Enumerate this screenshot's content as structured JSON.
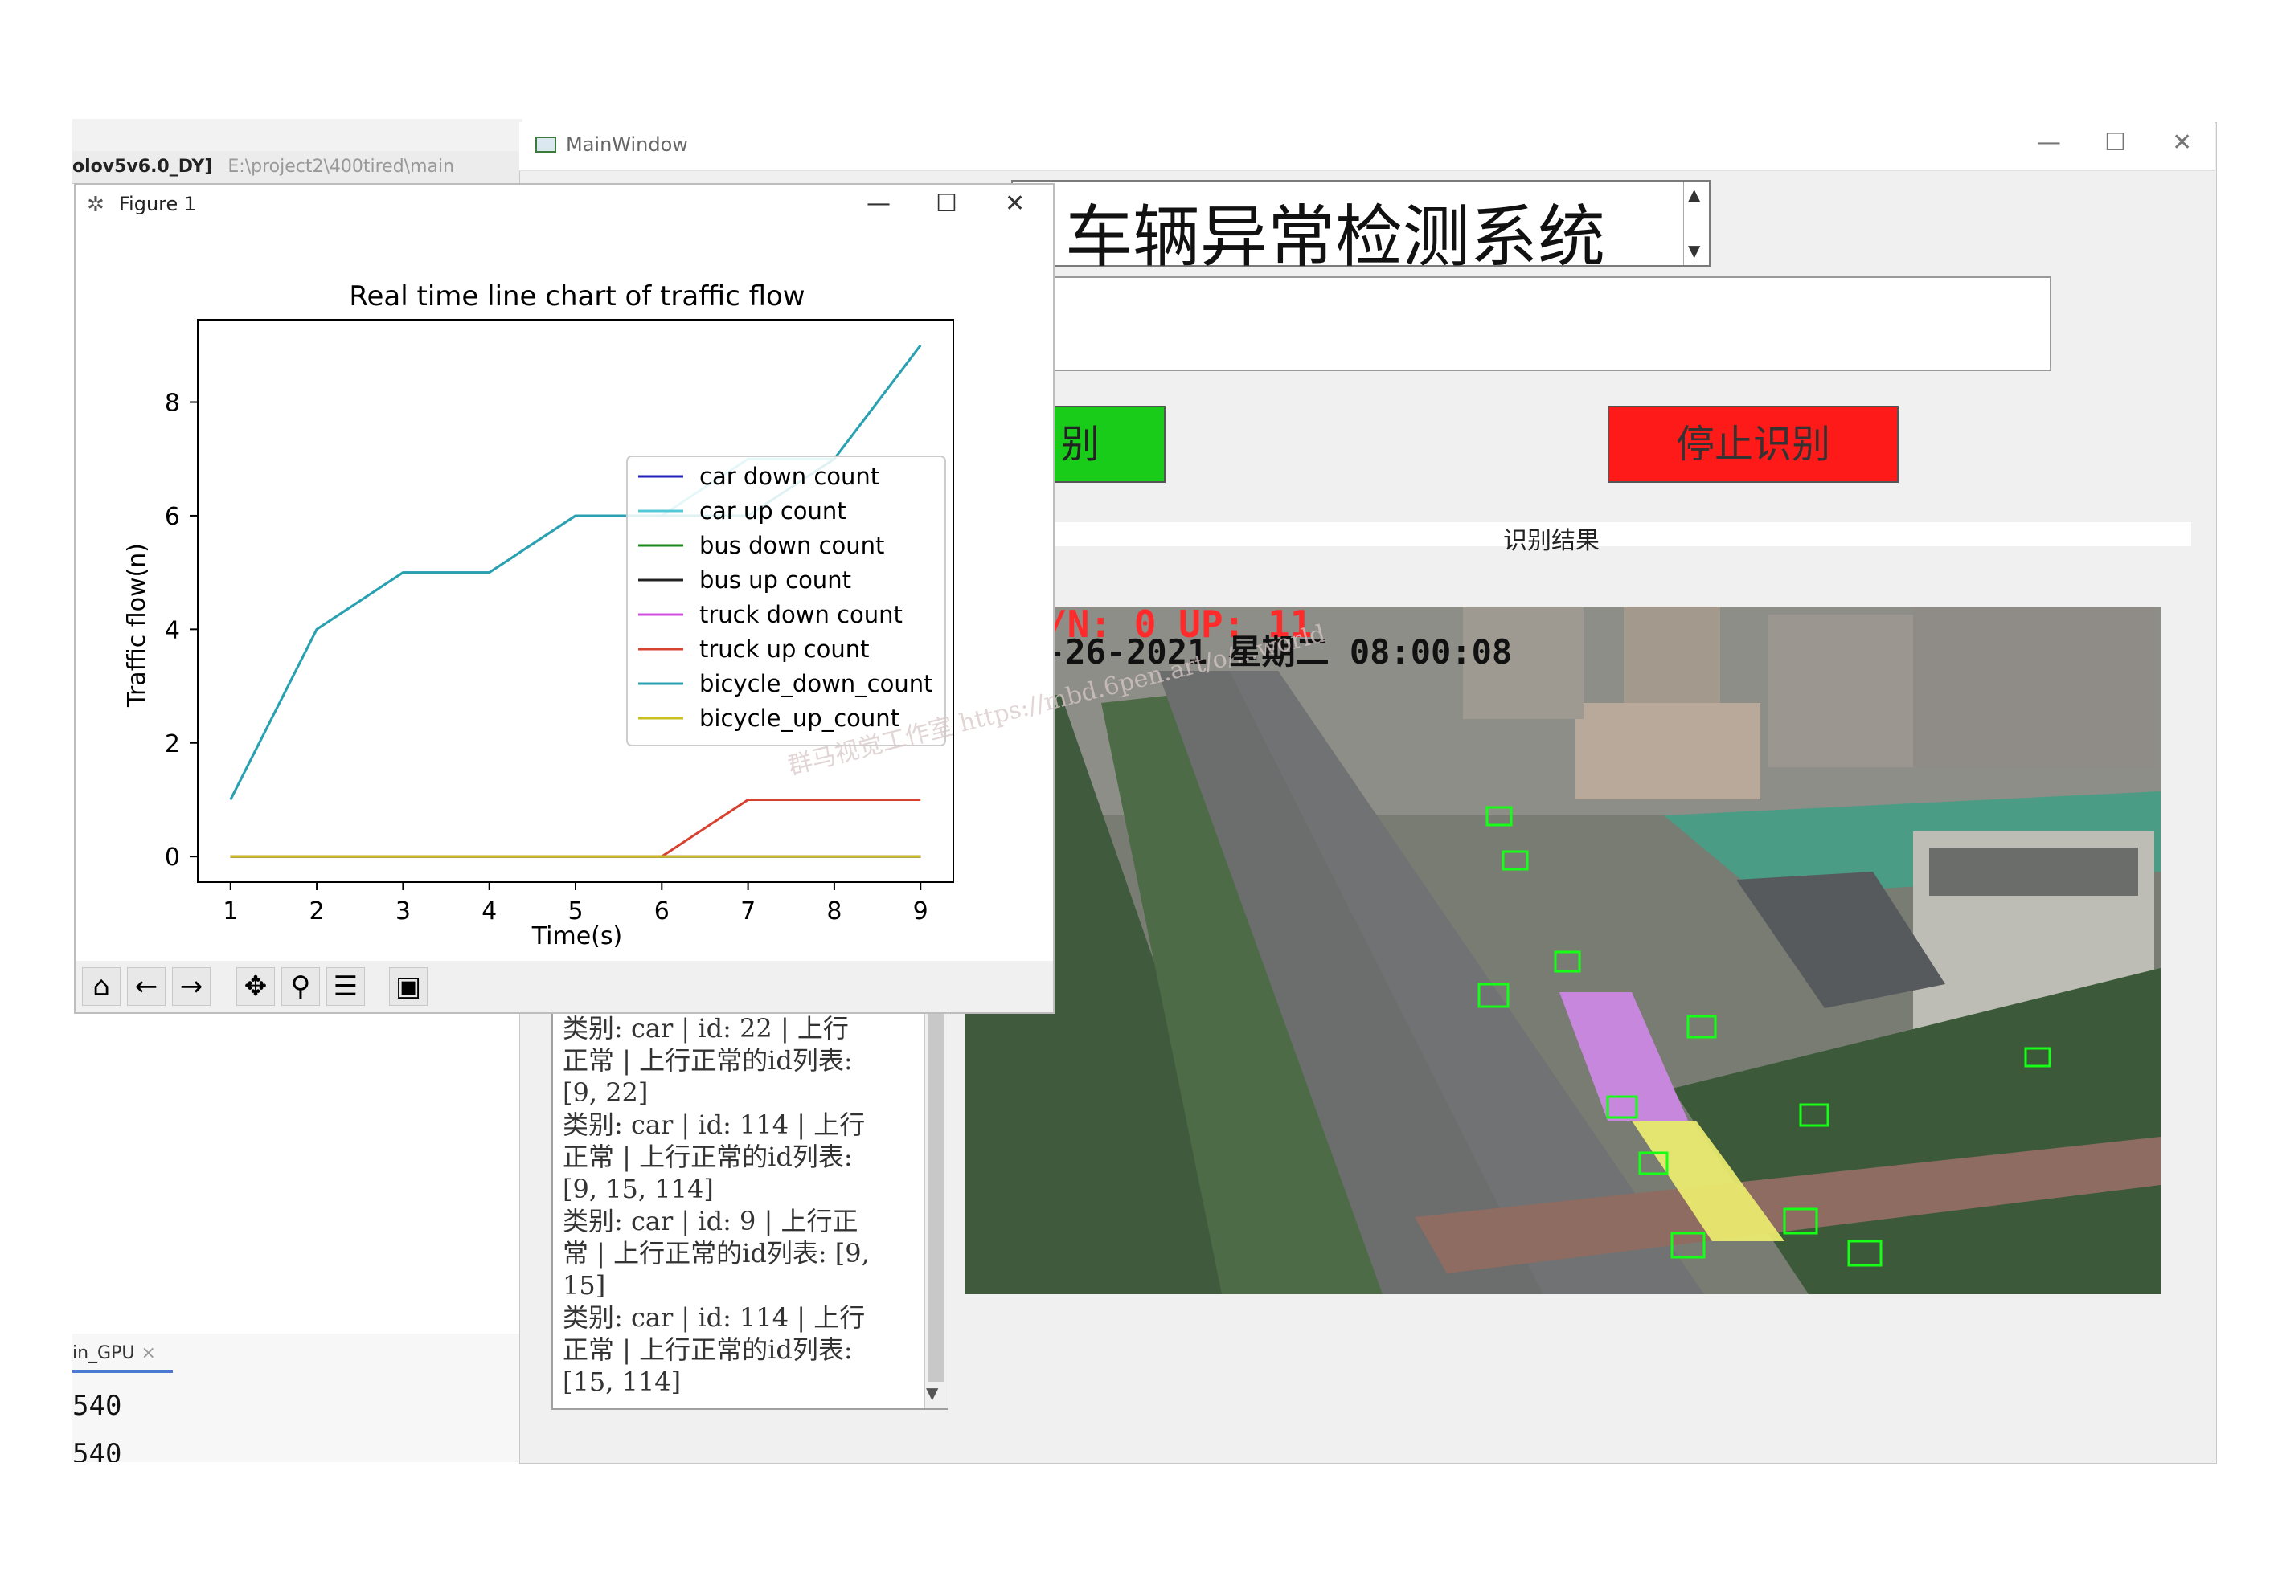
{
  "ide": {
    "project": "olov5v6.0_DY]",
    "path": "E:\\project2\\400tired\\main",
    "run_tab": "in_GPU",
    "run_tab_close": "×",
    "output_lines": [
      "540",
      "540"
    ]
  },
  "main_window": {
    "title": "MainWindow",
    "minimize": "—",
    "maximize": "☐",
    "close": "✕",
    "app_title": "车辆异常检测系统",
    "spin_up": "▲",
    "spin_down": "▼",
    "input_value": "",
    "start_label": "别",
    "stop_label": "停止识别",
    "result_label": "识别结果",
    "video": {
      "counter": "/N: 0   UP: 11",
      "timestamp": "-26-2021  星期二  08:00:08"
    },
    "log_lines": [
      "类别: car | id: 22 | 上行",
      "正常 | 上行正常的id列表:",
      "[9, 22]",
      "类别: car | id: 114 | 上行",
      "正常 | 上行正常的id列表:",
      "[9, 15, 114]",
      "类别: car | id: 9 | 上行正",
      "常 | 上行正常的id列表: [9,",
      "15]",
      "类别: car | id: 114 | 上行",
      "正常 | 上行正常的id列表:",
      "[15, 114]"
    ],
    "log_scroll_down": "▼"
  },
  "figure": {
    "window_title": "Figure 1",
    "icon": "✲",
    "minimize": "—",
    "maximize": "☐",
    "close": "✕",
    "toolbar": {
      "home": "⌂",
      "back": "←",
      "forward": "→",
      "pan": "✥",
      "zoom": "⚲",
      "configure": "☰",
      "save": "▣"
    }
  },
  "watermark": "群马视觉工作室 https://mbd.6pen.art/o/...world",
  "chart_data": {
    "type": "line",
    "title": "Real time line chart of traffic flow",
    "xlabel": "Time(s)",
    "ylabel": "Traffic flow(n)",
    "x": [
      1,
      2,
      3,
      4,
      5,
      6,
      7,
      8,
      9
    ],
    "xlim": [
      0.62,
      9.38
    ],
    "ylim": [
      -0.45,
      9.45
    ],
    "xticks": [
      1,
      2,
      3,
      4,
      5,
      6,
      7,
      8,
      9
    ],
    "yticks": [
      0,
      2,
      4,
      6,
      8
    ],
    "legend_position": "center-right",
    "grid": false,
    "series": [
      {
        "name": "car down count",
        "color": "#1f1fbf",
        "values": [
          0,
          0,
          0,
          0,
          0,
          0,
          0,
          0,
          0
        ]
      },
      {
        "name": "car up count",
        "color": "#55c8d8",
        "values": [
          1,
          4,
          5,
          5,
          6,
          6,
          7,
          7,
          9
        ]
      },
      {
        "name": "bus down count",
        "color": "#1a8a1a",
        "values": [
          0,
          0,
          0,
          0,
          0,
          0,
          0,
          0,
          0
        ]
      },
      {
        "name": "bus up count",
        "color": "#222222",
        "values": [
          0,
          0,
          0,
          0,
          0,
          0,
          0,
          0,
          0
        ]
      },
      {
        "name": "truck down count",
        "color": "#d24fe0",
        "values": [
          0,
          0,
          0,
          0,
          0,
          0,
          0,
          0,
          0
        ]
      },
      {
        "name": "truck up count",
        "color": "#d84030",
        "values": [
          0,
          0,
          0,
          0,
          0,
          0,
          1,
          1,
          1
        ]
      },
      {
        "name": "bicycle_down_count",
        "color": "#2aa0b0",
        "values": [
          1,
          4,
          5,
          5,
          6,
          6,
          6,
          7,
          9
        ]
      },
      {
        "name": "bicycle_up_count",
        "color": "#c8c020",
        "values": [
          0,
          0,
          0,
          0,
          0,
          0,
          0,
          0,
          0
        ]
      }
    ]
  }
}
